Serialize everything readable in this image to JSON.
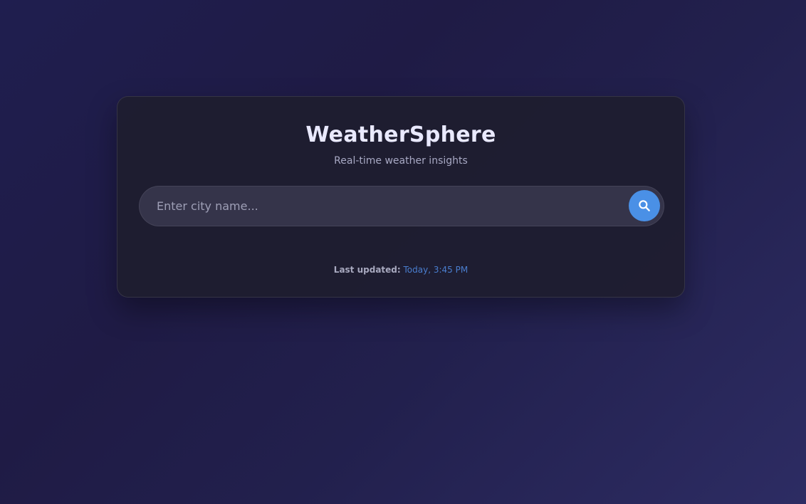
{
  "app": {
    "title": "WeatherSphere",
    "subtitle": "Real-time weather insights"
  },
  "search": {
    "placeholder": "Enter city name...",
    "value": "",
    "button_icon": "search-icon"
  },
  "status": {
    "last_updated_label": "Last updated:",
    "last_updated_value": "Today, 3:45 PM"
  },
  "colors": {
    "accent": "#4a90e6",
    "card_background": "#1e1d2f",
    "background_start": "#1f1e4f",
    "background_end": "#2d2c63",
    "timestamp": "#4a7ecf"
  }
}
